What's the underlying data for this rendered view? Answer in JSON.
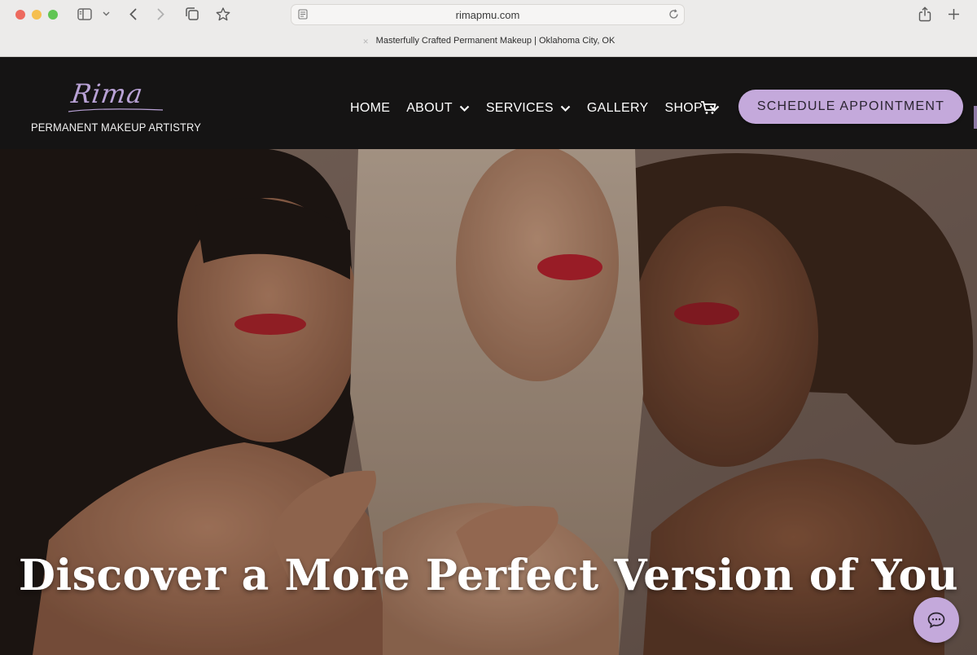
{
  "browser": {
    "url": "rimapmu.com",
    "tab_title": "Masterfully Crafted Permanent Makeup | Oklahoma City, OK",
    "icons": [
      "sidebar-icon",
      "chevron-down-icon",
      "back-icon",
      "forward-icon",
      "tabs-overview-icon",
      "bookmark-star-icon",
      "page-icon",
      "reload-icon",
      "share-icon",
      "new-tab-plus-icon"
    ]
  },
  "site": {
    "logo_script": "Rima",
    "logo_subtitle": "PERMANENT MAKEUP ARTISTRY",
    "nav": [
      {
        "label": "HOME",
        "has_dropdown": false
      },
      {
        "label": "ABOUT",
        "has_dropdown": true
      },
      {
        "label": "SERVICES",
        "has_dropdown": true
      },
      {
        "label": "GALLERY",
        "has_dropdown": false
      },
      {
        "label": "SHOP",
        "has_dropdown": true
      }
    ],
    "cart_icon": "cart-icon",
    "cta_label": "SCHEDULE APPOINTMENT",
    "colors": {
      "header_bg": "#151414",
      "accent_lavender": "#c4a9db",
      "logo_script": "#b9a2d6",
      "headline_text": "#ffffff"
    }
  },
  "hero": {
    "headline": "Discover a More Perfect Version of You",
    "image": "three-women-portrait",
    "chat_icon": "chat-bubble-icon"
  }
}
